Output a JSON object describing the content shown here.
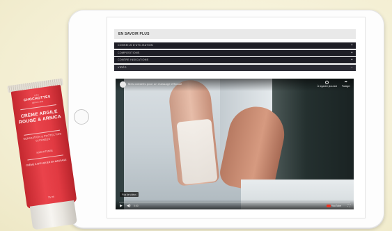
{
  "section": {
    "title": "EN SAVOIR PLUS"
  },
  "accordion": [
    {
      "label": "CONSEILS D'UTILISATION",
      "toggle": "+"
    },
    {
      "label": "COMPOSITIONS",
      "toggle": "+"
    },
    {
      "label": "CONTRE INDICATIONS",
      "toggle": "+"
    },
    {
      "label": "VIDÉO",
      "toggle": "−"
    }
  ],
  "video": {
    "title": "Mes conseils pour un massage efficace",
    "watch_later": "À regarder plus tard",
    "share": "Partager",
    "more_videos": "Plus de vidéos",
    "time": "0:00",
    "youtube_label": "YouTube"
  },
  "product": {
    "brand_top": "LES",
    "brand": "CHOCHOTTES",
    "brand_sub": "DEPUIS 1948",
    "name": "CRÈME ARGILE ROUGE & ARNICA",
    "claim": "RÉPARATION & PROTECTION CUTANÉES",
    "claim2": "SOIN INTENSE",
    "desc": "CRÈME À APPLIQUER EN MASSAGE",
    "volume": "75 ml"
  }
}
